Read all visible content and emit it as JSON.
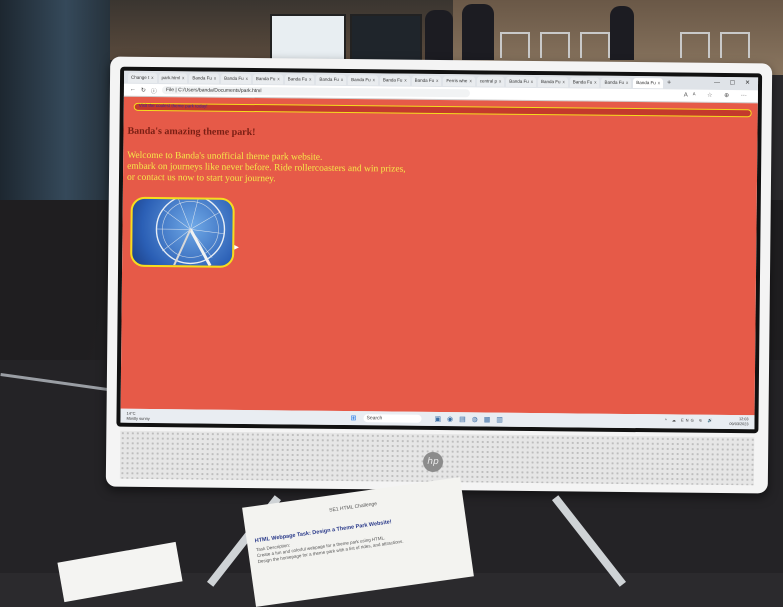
{
  "browser": {
    "tabs": [
      {
        "label": "Change t"
      },
      {
        "label": "park.html"
      },
      {
        "label": "Banda Fu"
      },
      {
        "label": "Banda Fu"
      },
      {
        "label": "Banda Fu"
      },
      {
        "label": "Banda Fu"
      },
      {
        "label": "Banda Fu"
      },
      {
        "label": "Banda Fu"
      },
      {
        "label": "Banda Fu"
      },
      {
        "label": "Banda Fu"
      },
      {
        "label": "Ferris whe"
      },
      {
        "label": "central p"
      },
      {
        "label": "Banda Fu"
      },
      {
        "label": "Banda Fu"
      },
      {
        "label": "Banda Fu"
      },
      {
        "label": "Banda Fu"
      },
      {
        "label": "Banda Fu"
      }
    ],
    "close_glyph": "x",
    "new_tab": "+",
    "window_controls": "— ▢ ✕",
    "address": "File | C:/Users/banda/Documents/park.html",
    "nav_back": "←",
    "nav_reload": "↻",
    "nav_info": "ⓘ",
    "right_icons": "Aᴬ ☆ ⊕ ⋯"
  },
  "page": {
    "marquee_text": "Visit the coolest theme park today!",
    "heading": "Banda's amazing theme park!",
    "intro_lines": [
      "Welcome to Banda's unofficial theme park website.",
      "embark on journeys like never before. Ride rollercoasters and win prizes,",
      "or contact us now to start your journey."
    ],
    "image_alt_icon": "ferris-wheel",
    "accent_background": "#e65a48",
    "accent_border": "#f5dd1e",
    "text_color": "#f6e84a",
    "heading_color": "#7a1f14"
  },
  "taskbar": {
    "weather": [
      "14°C",
      "Mostly sunny"
    ],
    "search": "Search",
    "apps": "▣ ◉ ▤ ◍ ▦ ▥",
    "start_glyph": "⊞",
    "tray": "^ ☁ ENG ⚟ 🔊",
    "time": "12:03",
    "date": "09/03/2023"
  },
  "monitor": {
    "brand": "hp"
  },
  "paper": {
    "title": "SE1 HTML Challenge",
    "task": "HTML Webpage Task: Design a Theme Park Website!",
    "body_lines": [
      "Task Description:",
      "Create a fun and colorful webpage for a theme park using HTML.",
      "Design the homepage for a theme park with a list of rides, and attractions."
    ]
  }
}
